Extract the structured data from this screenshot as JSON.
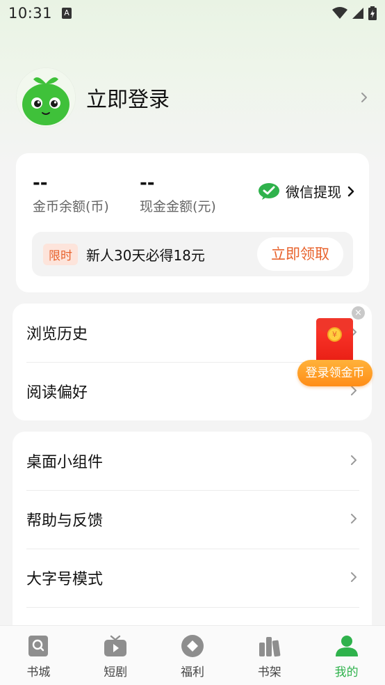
{
  "status_bar": {
    "time": "10:31",
    "notification_letter": "A"
  },
  "profile": {
    "login_label": "立即登录"
  },
  "coins": {
    "gold_value": "--",
    "gold_label": "金币余额(币)",
    "cash_value": "--",
    "cash_label": "现金金额(元)",
    "withdraw_label": "微信提现"
  },
  "promo": {
    "tag": "限时",
    "text": "新人30天必得18元",
    "button": "立即领取"
  },
  "list_group_1": [
    {
      "label": "浏览历史"
    },
    {
      "label": "阅读偏好"
    }
  ],
  "list_group_2": [
    {
      "label": "桌面小组件"
    },
    {
      "label": "帮助与反馈"
    },
    {
      "label": "大字号模式"
    }
  ],
  "floating": {
    "close": "×",
    "coin_symbol": "¥",
    "button": "登录领金币"
  },
  "bottom_nav": [
    {
      "label": "书城",
      "icon": "search-book-icon",
      "active": false
    },
    {
      "label": "短剧",
      "icon": "tv-play-icon",
      "active": false
    },
    {
      "label": "福利",
      "icon": "welfare-icon",
      "active": false
    },
    {
      "label": "书架",
      "icon": "bookshelf-icon",
      "active": false
    },
    {
      "label": "我的",
      "icon": "person-icon",
      "active": true
    }
  ],
  "colors": {
    "accent_green": "#2fb24c",
    "promo_orange": "#e8632d",
    "red_packet": "#e81e14",
    "float_button": "#ff8d17"
  }
}
